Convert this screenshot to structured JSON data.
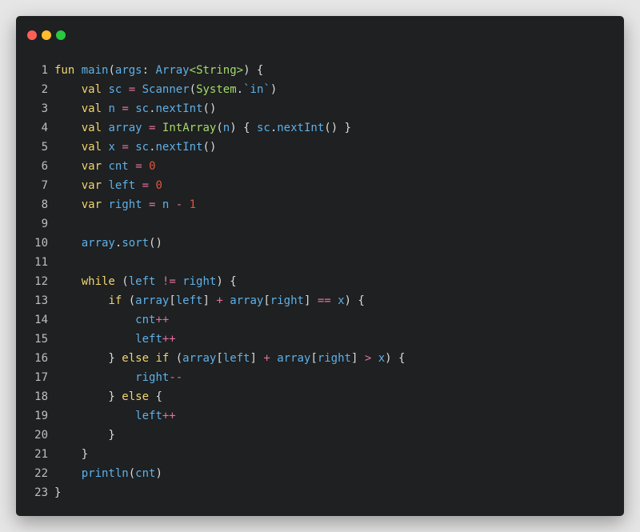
{
  "window": {
    "controls": [
      {
        "name": "close",
        "color": "#ff5f57"
      },
      {
        "name": "minimize",
        "color": "#febc2e"
      },
      {
        "name": "maximize",
        "color": "#28c840"
      }
    ]
  },
  "colors": {
    "keyword": "#f3d56e",
    "identifier": "#5fb0e8",
    "type": "#a6d86a",
    "number": "#e0553f",
    "operator": "#e36fa0",
    "punctuation": "#dcdcdc",
    "line_number": "#bfbfbf",
    "background": "#1e2021"
  },
  "lines": [
    {
      "n": "1",
      "tokens": [
        [
          "fun",
          "kw"
        ],
        [
          " ",
          "pn"
        ],
        [
          "main",
          "id"
        ],
        [
          "(",
          "pn"
        ],
        [
          "args",
          "id"
        ],
        [
          ": ",
          "pn"
        ],
        [
          "Array",
          "id"
        ],
        [
          "<",
          "ty"
        ],
        [
          "String",
          "ty"
        ],
        [
          ">",
          "ty"
        ],
        [
          ") {",
          "pn"
        ]
      ]
    },
    {
      "n": "2",
      "tokens": [
        [
          "    ",
          "pn"
        ],
        [
          "val",
          "kw"
        ],
        [
          " ",
          "pn"
        ],
        [
          "sc",
          "id"
        ],
        [
          " ",
          "pn"
        ],
        [
          "=",
          "op"
        ],
        [
          " ",
          "pn"
        ],
        [
          "Scanner",
          "id"
        ],
        [
          "(",
          "pn"
        ],
        [
          "System",
          "ty"
        ],
        [
          ".",
          "pn"
        ],
        [
          "`in`",
          "id"
        ],
        [
          ")",
          "pn"
        ]
      ]
    },
    {
      "n": "3",
      "tokens": [
        [
          "    ",
          "pn"
        ],
        [
          "val",
          "kw"
        ],
        [
          " ",
          "pn"
        ],
        [
          "n",
          "id"
        ],
        [
          " ",
          "pn"
        ],
        [
          "=",
          "op"
        ],
        [
          " ",
          "pn"
        ],
        [
          "sc",
          "id"
        ],
        [
          ".",
          "pn"
        ],
        [
          "nextInt",
          "id"
        ],
        [
          "()",
          "pn"
        ]
      ]
    },
    {
      "n": "4",
      "tokens": [
        [
          "    ",
          "pn"
        ],
        [
          "val",
          "kw"
        ],
        [
          " ",
          "pn"
        ],
        [
          "array",
          "id"
        ],
        [
          " ",
          "pn"
        ],
        [
          "=",
          "op"
        ],
        [
          " ",
          "pn"
        ],
        [
          "IntArray",
          "ty"
        ],
        [
          "(",
          "pn"
        ],
        [
          "n",
          "id"
        ],
        [
          ") { ",
          "pn"
        ],
        [
          "sc",
          "id"
        ],
        [
          ".",
          "pn"
        ],
        [
          "nextInt",
          "id"
        ],
        [
          "() }",
          "pn"
        ]
      ]
    },
    {
      "n": "5",
      "tokens": [
        [
          "    ",
          "pn"
        ],
        [
          "val",
          "kw"
        ],
        [
          " ",
          "pn"
        ],
        [
          "x",
          "id"
        ],
        [
          " ",
          "pn"
        ],
        [
          "=",
          "op"
        ],
        [
          " ",
          "pn"
        ],
        [
          "sc",
          "id"
        ],
        [
          ".",
          "pn"
        ],
        [
          "nextInt",
          "id"
        ],
        [
          "()",
          "pn"
        ]
      ]
    },
    {
      "n": "6",
      "tokens": [
        [
          "    ",
          "pn"
        ],
        [
          "var",
          "kw"
        ],
        [
          " ",
          "pn"
        ],
        [
          "cnt",
          "id"
        ],
        [
          " ",
          "pn"
        ],
        [
          "=",
          "op"
        ],
        [
          " ",
          "pn"
        ],
        [
          "0",
          "num"
        ]
      ]
    },
    {
      "n": "7",
      "tokens": [
        [
          "    ",
          "pn"
        ],
        [
          "var",
          "kw"
        ],
        [
          " ",
          "pn"
        ],
        [
          "left",
          "id"
        ],
        [
          " ",
          "pn"
        ],
        [
          "=",
          "op"
        ],
        [
          " ",
          "pn"
        ],
        [
          "0",
          "num"
        ]
      ]
    },
    {
      "n": "8",
      "tokens": [
        [
          "    ",
          "pn"
        ],
        [
          "var",
          "kw"
        ],
        [
          " ",
          "pn"
        ],
        [
          "right",
          "id"
        ],
        [
          " ",
          "pn"
        ],
        [
          "=",
          "op"
        ],
        [
          " ",
          "pn"
        ],
        [
          "n",
          "id"
        ],
        [
          " ",
          "pn"
        ],
        [
          "-",
          "op"
        ],
        [
          " ",
          "pn"
        ],
        [
          "1",
          "num"
        ]
      ]
    },
    {
      "n": "9",
      "tokens": []
    },
    {
      "n": "10",
      "tokens": [
        [
          "    ",
          "pn"
        ],
        [
          "array",
          "id"
        ],
        [
          ".",
          "pn"
        ],
        [
          "sort",
          "id"
        ],
        [
          "()",
          "pn"
        ]
      ]
    },
    {
      "n": "11",
      "tokens": []
    },
    {
      "n": "12",
      "tokens": [
        [
          "    ",
          "pn"
        ],
        [
          "while",
          "kw"
        ],
        [
          " (",
          "pn"
        ],
        [
          "left",
          "id"
        ],
        [
          " ",
          "pn"
        ],
        [
          "!=",
          "op"
        ],
        [
          " ",
          "pn"
        ],
        [
          "right",
          "id"
        ],
        [
          ") {",
          "pn"
        ]
      ]
    },
    {
      "n": "13",
      "tokens": [
        [
          "        ",
          "pn"
        ],
        [
          "if",
          "kw"
        ],
        [
          " (",
          "pn"
        ],
        [
          "array",
          "id"
        ],
        [
          "[",
          "pn"
        ],
        [
          "left",
          "id"
        ],
        [
          "] ",
          "pn"
        ],
        [
          "+",
          "op"
        ],
        [
          " ",
          "pn"
        ],
        [
          "array",
          "id"
        ],
        [
          "[",
          "pn"
        ],
        [
          "right",
          "id"
        ],
        [
          "] ",
          "pn"
        ],
        [
          "==",
          "op"
        ],
        [
          " ",
          "pn"
        ],
        [
          "x",
          "id"
        ],
        [
          ") {",
          "pn"
        ]
      ]
    },
    {
      "n": "14",
      "tokens": [
        [
          "            ",
          "pn"
        ],
        [
          "cnt",
          "id"
        ],
        [
          "++",
          "op"
        ]
      ]
    },
    {
      "n": "15",
      "tokens": [
        [
          "            ",
          "pn"
        ],
        [
          "left",
          "id"
        ],
        [
          "++",
          "op"
        ]
      ]
    },
    {
      "n": "16",
      "tokens": [
        [
          "        } ",
          "pn"
        ],
        [
          "else",
          "kw"
        ],
        [
          " ",
          "pn"
        ],
        [
          "if",
          "kw"
        ],
        [
          " (",
          "pn"
        ],
        [
          "array",
          "id"
        ],
        [
          "[",
          "pn"
        ],
        [
          "left",
          "id"
        ],
        [
          "] ",
          "pn"
        ],
        [
          "+",
          "op"
        ],
        [
          " ",
          "pn"
        ],
        [
          "array",
          "id"
        ],
        [
          "[",
          "pn"
        ],
        [
          "right",
          "id"
        ],
        [
          "] ",
          "pn"
        ],
        [
          ">",
          "op"
        ],
        [
          " ",
          "pn"
        ],
        [
          "x",
          "id"
        ],
        [
          ") {",
          "pn"
        ]
      ]
    },
    {
      "n": "17",
      "tokens": [
        [
          "            ",
          "pn"
        ],
        [
          "right",
          "id"
        ],
        [
          "--",
          "op"
        ]
      ]
    },
    {
      "n": "18",
      "tokens": [
        [
          "        } ",
          "pn"
        ],
        [
          "else",
          "kw"
        ],
        [
          " {",
          "pn"
        ]
      ]
    },
    {
      "n": "19",
      "tokens": [
        [
          "            ",
          "pn"
        ],
        [
          "left",
          "id"
        ],
        [
          "++",
          "op"
        ]
      ]
    },
    {
      "n": "20",
      "tokens": [
        [
          "        }",
          "pn"
        ]
      ]
    },
    {
      "n": "21",
      "tokens": [
        [
          "    }",
          "pn"
        ]
      ]
    },
    {
      "n": "22",
      "tokens": [
        [
          "    ",
          "pn"
        ],
        [
          "println",
          "id"
        ],
        [
          "(",
          "pn"
        ],
        [
          "cnt",
          "id"
        ],
        [
          ")",
          "pn"
        ]
      ]
    },
    {
      "n": "23",
      "tokens": [
        [
          "}",
          "pn"
        ]
      ]
    }
  ]
}
